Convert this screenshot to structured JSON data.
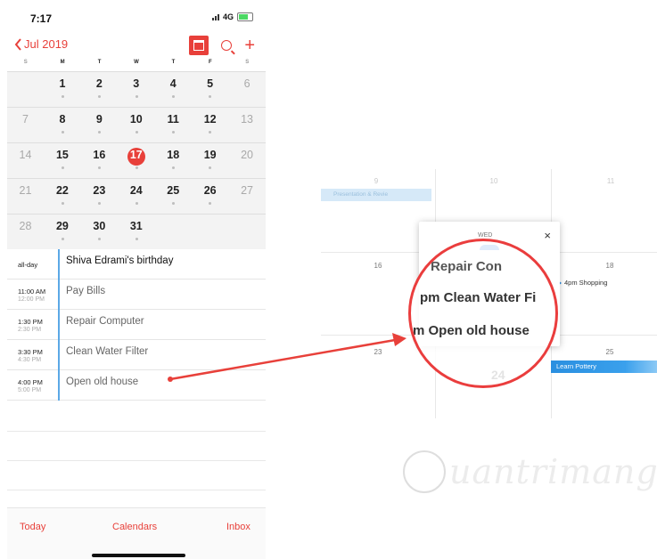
{
  "status": {
    "time": "7:17",
    "network": "4G"
  },
  "nav": {
    "back_label": "Jul 2019",
    "plus": "+"
  },
  "weekdays": [
    "S",
    "M",
    "T",
    "W",
    "T",
    "F",
    "S"
  ],
  "weeks": [
    [
      "",
      "1",
      "2",
      "3",
      "4",
      "5",
      "6"
    ],
    [
      "7",
      "8",
      "9",
      "10",
      "11",
      "12",
      "13"
    ],
    [
      "14",
      "15",
      "16",
      "17",
      "18",
      "19",
      "20"
    ],
    [
      "21",
      "22",
      "23",
      "24",
      "25",
      "26",
      "27"
    ],
    [
      "28",
      "29",
      "30",
      "31",
      "",
      "",
      ""
    ]
  ],
  "today": "17",
  "events": [
    {
      "start": "all-day",
      "end": "",
      "title": "Shiva Edrami's birthday",
      "bold": true
    },
    {
      "start": "11:00 AM",
      "end": "12:00 PM",
      "title": "Pay Bills",
      "bold": false
    },
    {
      "start": "1:30 PM",
      "end": "2:30 PM",
      "title": "Repair Computer",
      "bold": false
    },
    {
      "start": "3:30 PM",
      "end": "4:30 PM",
      "title": "Clean Water Filter",
      "bold": false
    },
    {
      "start": "4:00 PM",
      "end": "5:00 PM",
      "title": "Open old house",
      "bold": false
    }
  ],
  "tabs": {
    "today": "Today",
    "calendars": "Calendars",
    "inbox": "Inbox"
  },
  "web_calendar": {
    "top_dates": [
      "9",
      "10",
      "11"
    ],
    "mid_dates": [
      "16",
      "18"
    ],
    "bottom_dates": [
      "23",
      "25"
    ],
    "popup_day": "WED",
    "popup_close": "×",
    "big_date": "24",
    "presentation_event": "Presentation & Revie",
    "shopping_event": "4pm Shopping",
    "pottery_event": "Learn Pottery"
  },
  "magnifier": {
    "line1": "Repair Con",
    "line2": "pm Clean Water Fi",
    "line3": "m Open old house"
  },
  "watermark": "uantrimang",
  "colors": {
    "accent": "#e8403a",
    "event_bar": "#5ba8e6",
    "circle": "#ea3d3d",
    "arrow": "#e8403a"
  }
}
